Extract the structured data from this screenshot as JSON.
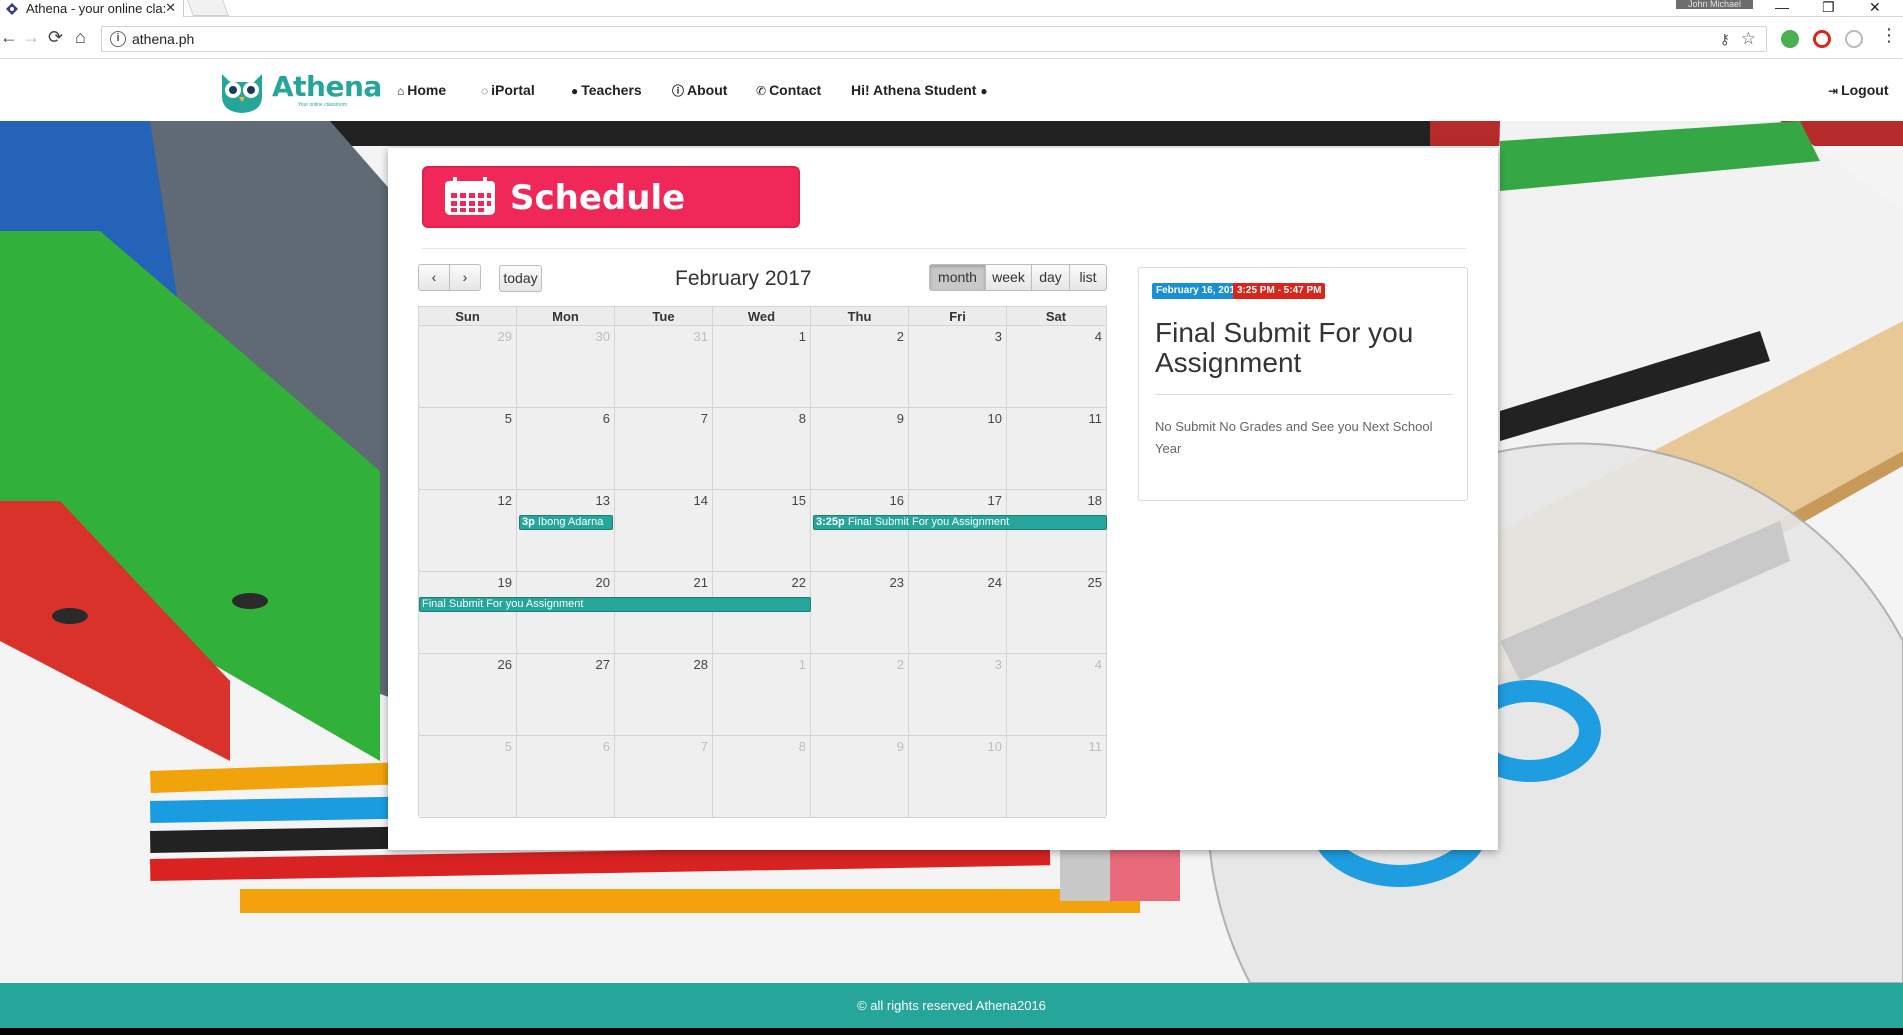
{
  "browser": {
    "tab_title": "Athena - your online cla:",
    "url": "athena.ph",
    "user_badge": "John Michael"
  },
  "site": {
    "brand": "Athena",
    "tagline": "Your online classroom",
    "nav": [
      {
        "icon": "home-icon",
        "label": "Home"
      },
      {
        "icon": "comment-icon",
        "label": "iPortal"
      },
      {
        "icon": "user-icon",
        "label": "Teachers"
      },
      {
        "icon": "info-icon",
        "label": "About"
      },
      {
        "icon": "phone-icon",
        "label": "Contact"
      }
    ],
    "greeting": "Hi! Athena Student",
    "logout": "Logout"
  },
  "schedule": {
    "banner_title": "Schedule",
    "today_label": "today",
    "month_title": "February 2017",
    "views": [
      "month",
      "week",
      "day",
      "list"
    ],
    "active_view": "month",
    "weekdays": [
      "Sun",
      "Mon",
      "Tue",
      "Wed",
      "Thu",
      "Fri",
      "Sat"
    ],
    "weeks": [
      [
        {
          "d": "29",
          "o": true
        },
        {
          "d": "30",
          "o": true
        },
        {
          "d": "31",
          "o": true
        },
        {
          "d": "1"
        },
        {
          "d": "2"
        },
        {
          "d": "3"
        },
        {
          "d": "4"
        }
      ],
      [
        {
          "d": "5"
        },
        {
          "d": "6"
        },
        {
          "d": "7"
        },
        {
          "d": "8"
        },
        {
          "d": "9"
        },
        {
          "d": "10"
        },
        {
          "d": "11"
        }
      ],
      [
        {
          "d": "12"
        },
        {
          "d": "13"
        },
        {
          "d": "14"
        },
        {
          "d": "15"
        },
        {
          "d": "16"
        },
        {
          "d": "17"
        },
        {
          "d": "18"
        }
      ],
      [
        {
          "d": "19"
        },
        {
          "d": "20"
        },
        {
          "d": "21"
        },
        {
          "d": "22"
        },
        {
          "d": "23"
        },
        {
          "d": "24"
        },
        {
          "d": "25"
        }
      ],
      [
        {
          "d": "26"
        },
        {
          "d": "27"
        },
        {
          "d": "28"
        },
        {
          "d": "1",
          "o": true
        },
        {
          "d": "2",
          "o": true
        },
        {
          "d": "3",
          "o": true
        },
        {
          "d": "4",
          "o": true
        }
      ],
      [
        {
          "d": "5",
          "o": true
        },
        {
          "d": "6",
          "o": true
        },
        {
          "d": "7",
          "o": true
        },
        {
          "d": "8",
          "o": true
        },
        {
          "d": "9",
          "o": true
        },
        {
          "d": "10",
          "o": true
        },
        {
          "d": "11",
          "o": true
        }
      ]
    ],
    "events": [
      {
        "time": "3p",
        "title": "Ibong Adarna"
      },
      {
        "time": "3:25p",
        "title": "Final Submit For you Assignment"
      },
      {
        "time": "",
        "title": "Final Submit For you Assignment"
      }
    ],
    "event_color": "#26a69a"
  },
  "detail": {
    "date_badge": "February 16, 2017",
    "time_badge": "3:25 PM - 5:47 PM",
    "title": "Final Submit For you Assignment",
    "description": "No Submit No Grades and See you Next School Year",
    "date_color": "#1a8fd6",
    "time_color": "#d9261c"
  },
  "footer": {
    "text": "© all rights reserved Athena2016"
  }
}
